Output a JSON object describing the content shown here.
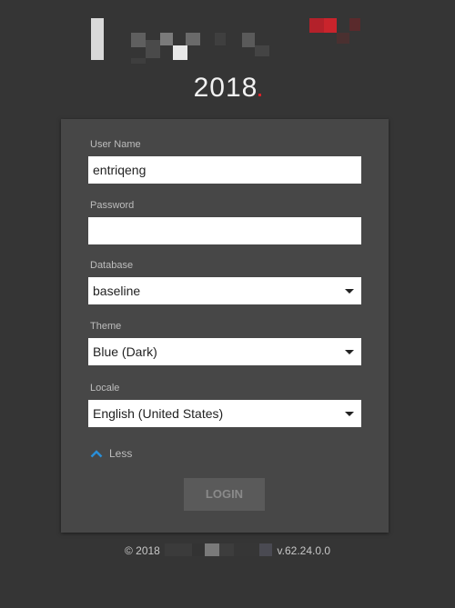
{
  "header": {
    "year": "2018"
  },
  "form": {
    "username": {
      "label": "User Name",
      "value": "entriqeng"
    },
    "password": {
      "label": "Password",
      "value": ""
    },
    "database": {
      "label": "Database",
      "value": "baseline"
    },
    "theme": {
      "label": "Theme",
      "value": "Blue (Dark)"
    },
    "locale": {
      "label": "Locale",
      "value": "English (United States)"
    },
    "less_toggle": "Less",
    "login_label": "LOGIN"
  },
  "footer": {
    "copyright": "© 2018",
    "version": "v.62.24.0.0"
  },
  "colors": {
    "background": "#353535",
    "card": "#474747",
    "accent_blue": "#2a8fd8",
    "brand_red": "#d8232a",
    "login_button": "#5a5a5a"
  },
  "icons": {
    "less_toggle": "chevron-up-icon",
    "select_caret": "caret-down-icon"
  }
}
